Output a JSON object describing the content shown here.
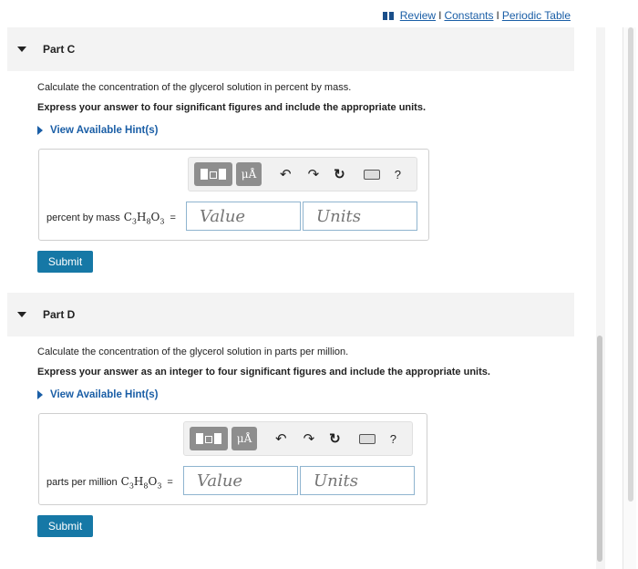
{
  "topbar": {
    "review": "Review",
    "constants": "Constants",
    "periodic_table": "Periodic Table",
    "sep": "I"
  },
  "partC": {
    "title": "Part C",
    "question": "Calculate the concentration of the glycerol solution in percent by mass.",
    "instruction": "Express your answer to four significant figures and include the appropriate units.",
    "hint": "View Available Hint(s)",
    "label": "percent by mass",
    "value_placeholder": "Value",
    "units_placeholder": "Units",
    "submit": "Submit"
  },
  "partD": {
    "title": "Part D",
    "question": "Calculate the concentration of the glycerol solution in parts per million.",
    "instruction": "Express your answer as an integer to four significant figures and include the appropriate units.",
    "hint": "View Available Hint(s)",
    "label": "parts per million",
    "value_placeholder": "Value",
    "units_placeholder": "Units",
    "submit": "Submit"
  },
  "toolbar": {
    "units_btn": "μÅ",
    "undo": "↶",
    "redo": "↷",
    "reset": "↻",
    "help": "?"
  },
  "formula": {
    "c": "C",
    "c_sub": "3",
    "h": "H",
    "h_sub": "8",
    "o": "O",
    "o_sub": "3",
    "eq": "="
  },
  "icons": [
    "book-icon",
    "template-icon",
    "undo-icon",
    "redo-icon",
    "reset-icon",
    "keyboard-icon",
    "help-icon"
  ]
}
